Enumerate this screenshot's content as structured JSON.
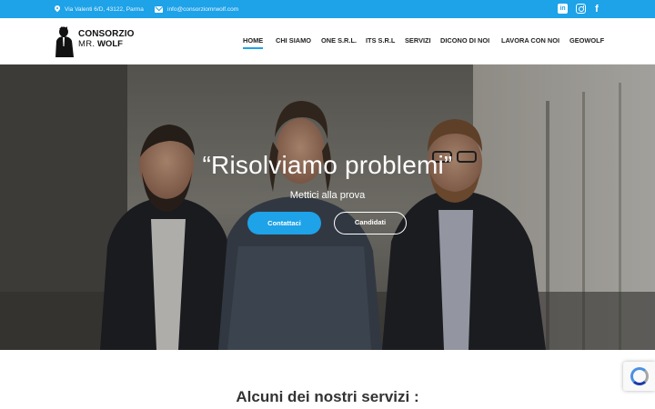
{
  "topbar": {
    "address": "Via Valenti 6/D, 43122, Parma",
    "email": "info@consorziomrwolf.com",
    "social": [
      {
        "icon": "linkedin-icon",
        "glyph": "in"
      },
      {
        "icon": "instagram-icon"
      },
      {
        "icon": "facebook-icon",
        "glyph": "f"
      }
    ]
  },
  "logo": {
    "line1": "CONSORZIO",
    "line2a": "MR.",
    "line2b": "WOLF"
  },
  "nav": {
    "items": [
      "HOME",
      "CHI SIAMO",
      "ONE S.R.L.",
      "ITS S.R.L",
      "SERVIZI",
      "DICONO DI NOI",
      "LAVORA CON NOI",
      "GEOWOLF"
    ],
    "active": "HOME"
  },
  "hero": {
    "title": "“Risolviamo problemi”",
    "subtitle": "Mettici alla prova",
    "primary_button": "Contattaci",
    "secondary_button": "Candidati"
  },
  "services": {
    "title": "Alcuni dei nostri servizi :"
  },
  "colors": {
    "accent": "#1ea2e8",
    "text": "#222222"
  }
}
